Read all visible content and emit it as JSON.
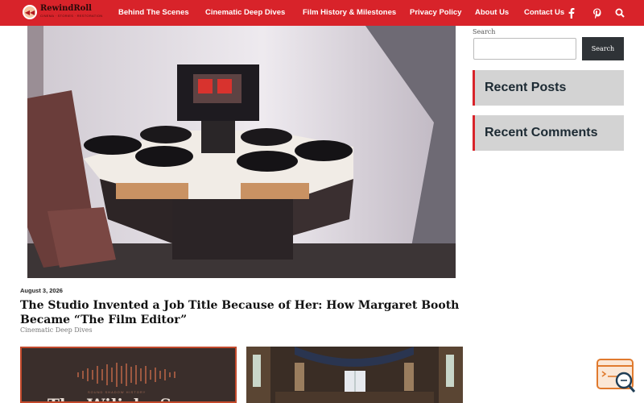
{
  "site": {
    "logo_name": "RewindRoll",
    "logo_tag": "CINEMA · STORIES · RESTORATION"
  },
  "nav": {
    "items": [
      "Behind The Scenes",
      "Cinematic Deep Dives",
      "Film History & Milestones",
      "Privacy Policy",
      "About Us",
      "Contact Us"
    ],
    "icons": [
      "facebook-icon",
      "pinterest-icon",
      "search-icon"
    ]
  },
  "featured_post": {
    "date": "August 3, 2026",
    "title": "The Studio Invented a Job Title Because of Her: How Margaret Booth Became “The Film Editor”",
    "category": "Cinematic Deep Dives"
  },
  "sidebar": {
    "search_label": "Search",
    "search_button": "Search",
    "search_placeholder": "",
    "widgets": [
      "Recent Posts",
      "Recent Comments"
    ]
  },
  "thumbs": {
    "first_tag": "SOUND SHADOW HISTORY",
    "first_title": "The Wiliaby S"
  },
  "colors": {
    "accent": "#d8232a",
    "button_dark": "#2f3337",
    "widget_bg": "#d3d3d3"
  }
}
